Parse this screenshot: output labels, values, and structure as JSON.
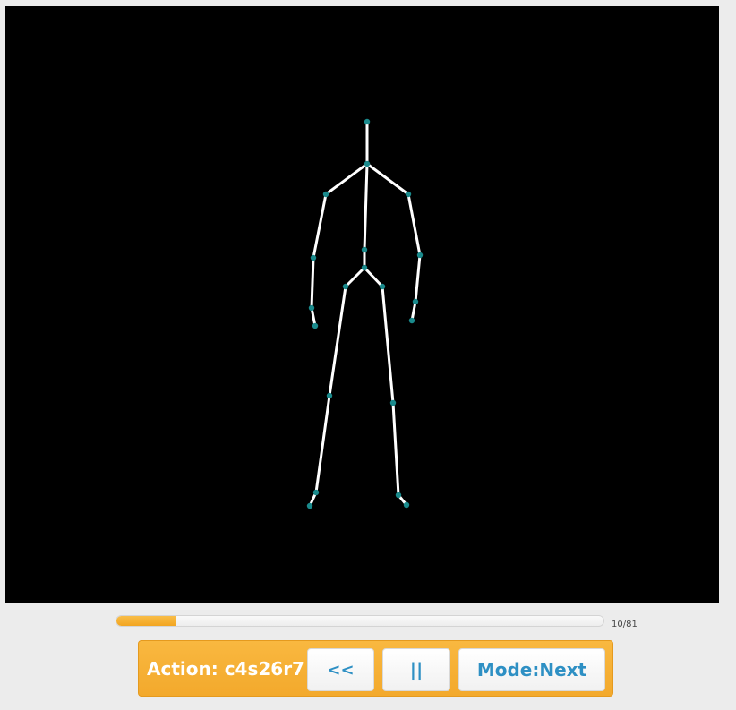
{
  "player": {
    "action_label": "Action: c4s26r7",
    "prev_label": "<<",
    "pause_label": "||",
    "mode_label": "Mode:Next",
    "frame_counter": "10/81",
    "progress_fraction": 0.123,
    "accent_color": "#f7b03a",
    "button_text_color": "#2e90c4",
    "joint_color": "#1a8a8c",
    "bone_color": "#ffffff",
    "background_color": "#000000"
  }
}
